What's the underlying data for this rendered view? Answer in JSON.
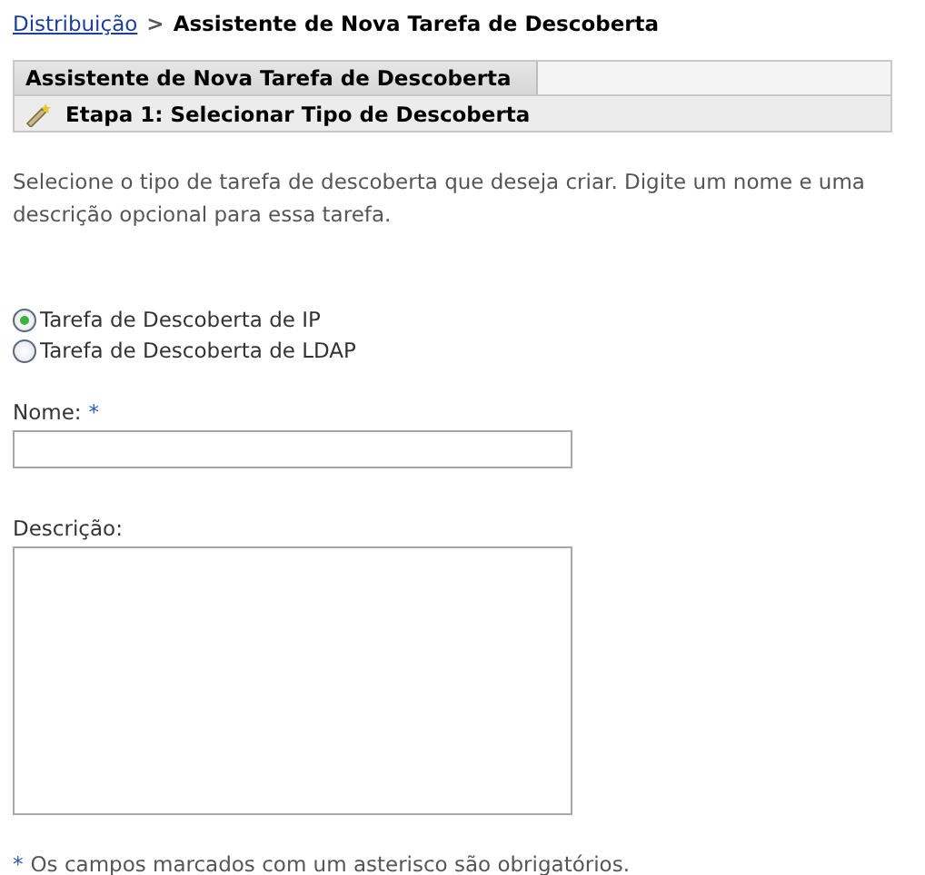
{
  "breadcrumb": {
    "link": "Distribuição",
    "separator": ">",
    "current": "Assistente de Nova Tarefa de Descoberta"
  },
  "panel": {
    "title": "Assistente de Nova Tarefa de Descoberta",
    "step": "Etapa 1: Selecionar Tipo de Descoberta"
  },
  "instructions": "Selecione o tipo de tarefa de descoberta que deseja criar. Digite um nome e uma descrição opcional para essa tarefa.",
  "task_types": [
    {
      "label": "Tarefa de Descoberta de IP",
      "selected": true
    },
    {
      "label": "Tarefa de Descoberta de LDAP",
      "selected": false
    }
  ],
  "fields": [
    {
      "kind": "input",
      "label": "Nome:",
      "required_mark": "*"
    },
    {
      "kind": "textarea",
      "label": "Descrição:"
    }
  ],
  "footnote": {
    "mark": "*",
    "text": "Os campos marcados com um asterisco são obrigatórios."
  }
}
